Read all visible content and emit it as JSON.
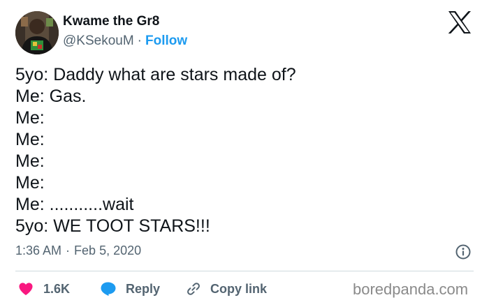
{
  "author": {
    "display_name": "Kwame the Gr8",
    "handle": "@KSekouM",
    "separator": "·",
    "follow_label": "Follow"
  },
  "tweet": {
    "lines": [
      "5yo: Daddy what are stars made of?",
      "Me: Gas.",
      "Me:",
      "Me:",
      "Me:",
      "Me:",
      "Me: ...........wait",
      "5yo: WE TOOT STARS!!!"
    ],
    "time": "1:36 AM",
    "date": "Feb 5, 2020"
  },
  "actions": {
    "likes_count": "1.6K",
    "reply_label": "Reply",
    "copy_link_label": "Copy link"
  },
  "watermark": "boredpanda.com",
  "colors": {
    "text": "#0f1419",
    "secondary_text": "#536471",
    "link_blue": "#1d9bf0",
    "like_pink": "#f91880",
    "divider": "#cfd9de"
  },
  "icons": {
    "platform_logo": "x-logo-icon",
    "info": "info-icon",
    "like": "heart-icon",
    "reply": "speech-bubble-icon",
    "copy_link": "link-icon"
  }
}
